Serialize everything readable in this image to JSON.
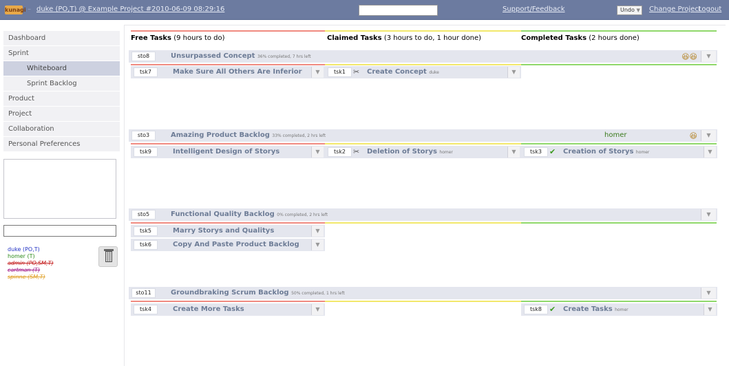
{
  "header": {
    "logo": "kunagi",
    "session_dash": "–",
    "session": "duke (PO,T) @ Example Project #2010-06-09 08:29:16",
    "support_label": "Support/Feedback",
    "undo_label": "Undo",
    "change_project_label": "Change Project",
    "logout_label": "Logout"
  },
  "sidebar": {
    "items": [
      {
        "label": "Dashboard"
      },
      {
        "label": "Sprint"
      },
      {
        "label": "Whiteboard"
      },
      {
        "label": "Sprint Backlog"
      },
      {
        "label": "Product"
      },
      {
        "label": "Project"
      },
      {
        "label": "Collaboration"
      },
      {
        "label": "Personal Preferences"
      }
    ],
    "users": [
      {
        "name": "duke (PO,T)",
        "color": "#2434c4"
      },
      {
        "name": "homer (T)",
        "color": "#2e8a1c"
      },
      {
        "name": "admin (PO,SM,T)",
        "color": "#c41e1e"
      },
      {
        "name": "cartman (T)",
        "color": "#a21e8a"
      },
      {
        "name": "spinne (SM,T)",
        "color": "#e0a028"
      }
    ]
  },
  "columns": {
    "free": {
      "title": "Free Tasks",
      "detail": "(9 hours to do)",
      "color": "#f08a80"
    },
    "claimed": {
      "title": "Claimed Tasks",
      "detail": "(3 hours to do, 1 hour done)",
      "color": "#f2e86a"
    },
    "completed": {
      "title": "Completed Tasks",
      "detail": "(2 hours done)",
      "color": "#8fd86a"
    }
  },
  "stories": [
    {
      "id": "sto8",
      "name": "Unsurpassed Concept",
      "meta": "36% completed, 7 hrs left",
      "smiles": "😆😆",
      "owner": "",
      "free": [
        {
          "id": "tsk7",
          "name": "Make Sure All Others Are Inferior"
        }
      ],
      "claimed": [
        {
          "id": "tsk1",
          "name": "Create Concept",
          "who": "duke"
        }
      ],
      "completed": []
    },
    {
      "id": "sto3",
      "name": "Amazing Product Backlog",
      "meta": "33% completed, 2 hrs left",
      "smiles": "😆",
      "owner": "homer",
      "free": [
        {
          "id": "tsk9",
          "name": "Intelligent Design of Storys"
        }
      ],
      "claimed": [
        {
          "id": "tsk2",
          "name": "Deletion of Storys",
          "who": "homer"
        }
      ],
      "completed": [
        {
          "id": "tsk3",
          "name": "Creation of Storys",
          "who": "homer"
        }
      ]
    },
    {
      "id": "sto5",
      "name": "Functional Quality Backlog",
      "meta": "0% completed, 2 hrs left",
      "smiles": "",
      "owner": "",
      "free": [
        {
          "id": "tsk5",
          "name": "Marry Storys and Qualitys"
        },
        {
          "id": "tsk6",
          "name": "Copy And Paste Product Backlog"
        }
      ],
      "claimed": [],
      "completed": []
    },
    {
      "id": "sto11",
      "name": "Groundbraking Scrum Backlog",
      "meta": "50% completed, 1 hrs left",
      "smiles": "",
      "owner": "",
      "free": [
        {
          "id": "tsk4",
          "name": "Create More Tasks"
        }
      ],
      "claimed": [],
      "completed": [
        {
          "id": "tsk8",
          "name": "Create Tasks",
          "who": "homer"
        }
      ]
    }
  ],
  "icons": {
    "scissors": "✂",
    "check": "✔",
    "dropdown": "▼"
  }
}
